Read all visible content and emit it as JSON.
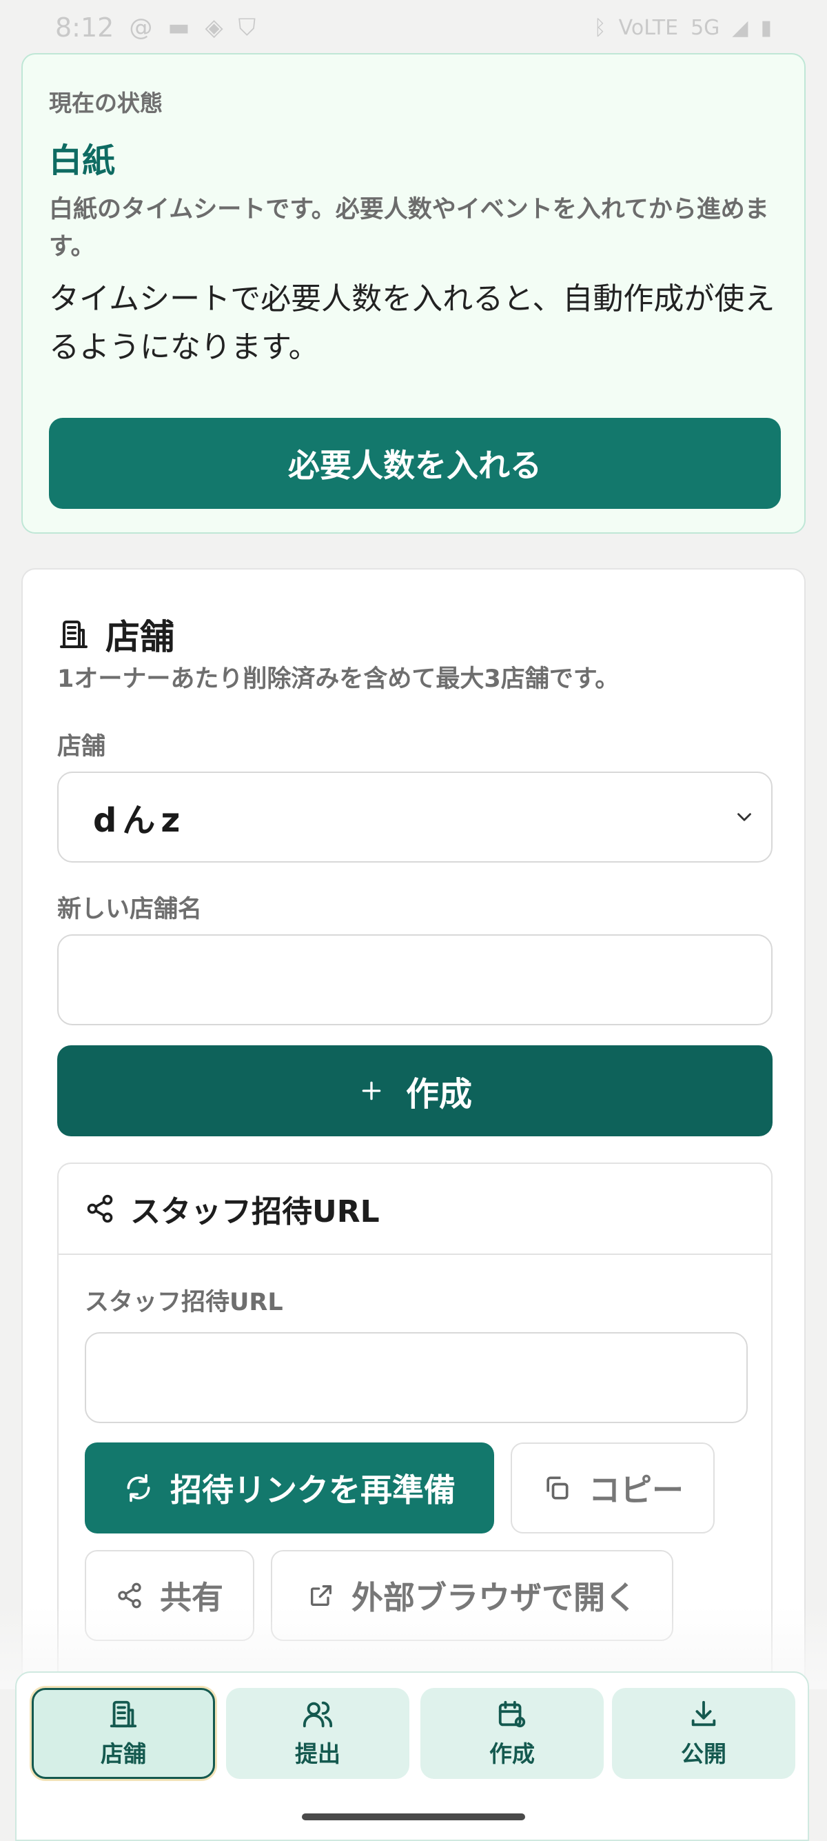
{
  "status_bar": {
    "time": "8:12",
    "volte": "VoLTE",
    "network": "5G"
  },
  "state_card": {
    "label": "現在の状態",
    "title": "白紙",
    "description": "白紙のタイムシートです。必要人数やイベントを入れてから進めます。",
    "note": "タイムシートで必要人数を入れると、自動作成が使えるようになります。",
    "button": "必要人数を入れる"
  },
  "store_card": {
    "title": "店舗",
    "note": "1オーナーあたり削除済みを含めて最大3店舗です。",
    "store_label": "店舗",
    "store_selected": "dんz",
    "new_store_label": "新しい店舗名",
    "new_store_value": "",
    "create_button": "作成",
    "create_icon": "plus-icon"
  },
  "invite_card": {
    "title": "スタッフ招待URL",
    "url_label": "スタッフ招待URL",
    "url_value": "",
    "regenerate_button": "招待リンクを再準備",
    "copy_button": "コピー",
    "share_button": "共有",
    "open_browser_button": "外部ブラウザで開く"
  },
  "bottom_nav": {
    "items": [
      {
        "label": "店舗",
        "icon": "store-icon",
        "active": true
      },
      {
        "label": "提出",
        "icon": "users-icon",
        "active": false
      },
      {
        "label": "作成",
        "icon": "calendar-gear-icon",
        "active": false
      },
      {
        "label": "公開",
        "icon": "download-icon",
        "active": false
      }
    ]
  },
  "colors": {
    "primary": "#13786c",
    "primary_dark": "#0e625a",
    "state_bg": "#f3fdf5",
    "nav_bg": "#dff2ec"
  }
}
